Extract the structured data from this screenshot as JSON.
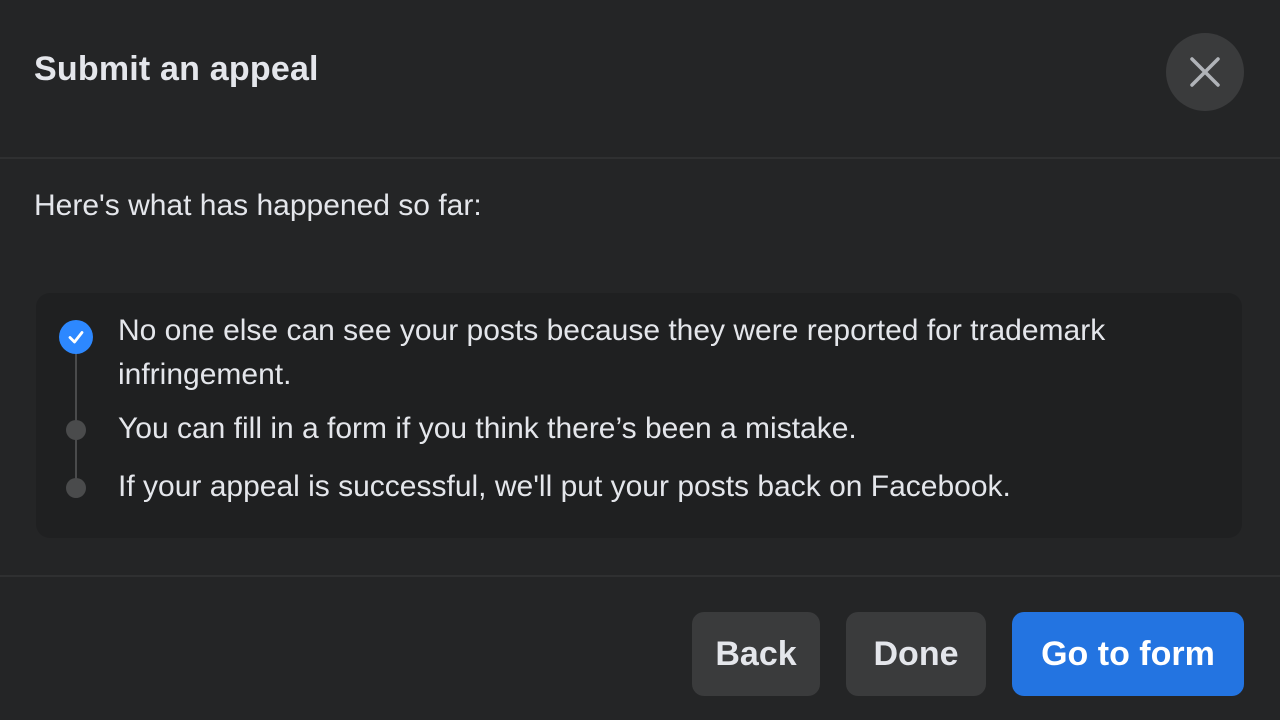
{
  "dialog": {
    "title": "Submit an appeal",
    "close_icon": "close-icon"
  },
  "intro": "Here's what has happened so far:",
  "timeline": {
    "steps": [
      {
        "text": "No one else can see your posts because they were reported for trademark infringement.",
        "status": "completed",
        "icon": "check-icon"
      },
      {
        "text": "You can fill in a form if you think there’s been a mistake.",
        "status": "pending"
      },
      {
        "text": "If your appeal is successful, we'll put your posts back on Facebook.",
        "status": "pending"
      }
    ]
  },
  "buttons": {
    "back": "Back",
    "done": "Done",
    "go_to_form": "Go to form"
  },
  "colors": {
    "background": "#242526",
    "card": "#1f2021",
    "accent": "#2374e1",
    "check": "#2d88ff",
    "secondary_button": "#3a3b3c",
    "text": "#e4e6eb"
  }
}
